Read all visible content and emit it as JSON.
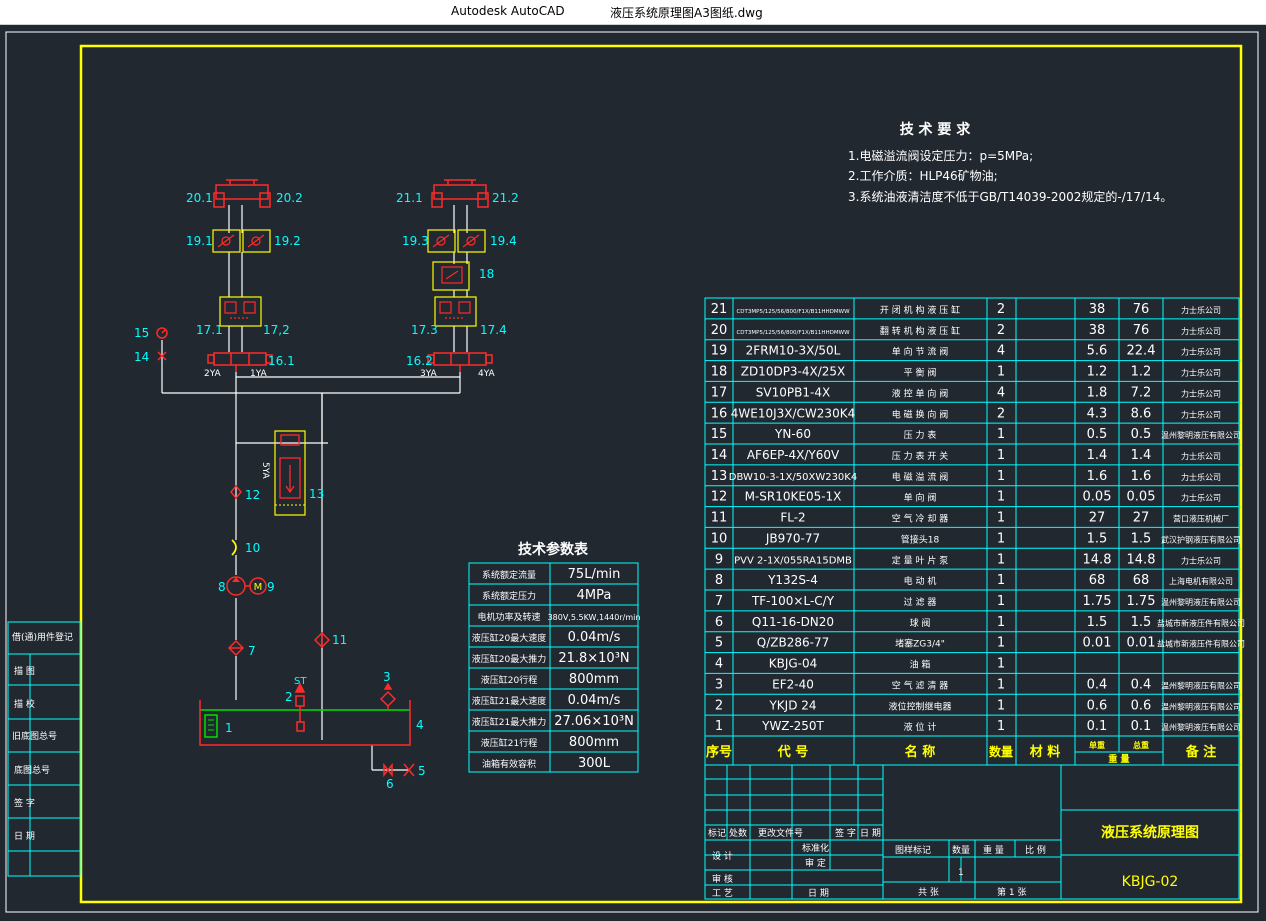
{
  "window": {
    "app_name": "Autodesk AutoCAD",
    "file_name": "液压系统原理图A3图纸.dwg"
  },
  "colors": {
    "background": "#212830",
    "frame": "#ffff00",
    "cyan": "#00ffff",
    "red": "#ff2a2a",
    "white": "#ffffff",
    "green": "#00e000"
  },
  "tech_requirements": {
    "title": "技 术 要 求",
    "lines": [
      "1.电磁溢流阀设定压力：p=5MPa;",
      "2.工作介质：HLP46矿物油;",
      "3.系统油液清洁度不低于GB/T14039-2002规定的-/17/14。"
    ]
  },
  "tech_params": {
    "title": "技术参数表",
    "rows": [
      [
        "系统额定流量",
        "75L/min"
      ],
      [
        "系统额定压力",
        "4MPa"
      ],
      [
        "电机功率及转速",
        "380V,5.5KW,1440r/min"
      ],
      [
        "液压缸20最大速度",
        "0.04m/s"
      ],
      [
        "液压缸20最大推力",
        "21.8×10³N"
      ],
      [
        "液压缸20行程",
        "800mm"
      ],
      [
        "液压缸21最大速度",
        "0.04m/s"
      ],
      [
        "液压缸21最大推力",
        "27.06×10³N"
      ],
      [
        "液压缸21行程",
        "800mm"
      ],
      [
        "油箱有效容积",
        "300L"
      ]
    ]
  },
  "bom": {
    "header": {
      "no": "序号",
      "code": "代    号",
      "name": "名    称",
      "qty": "数量",
      "material": "材  料",
      "unit_weight": "单重",
      "total_weight": "总重",
      "weight": "重  量",
      "remark": "备  注"
    },
    "rows": [
      [
        "21",
        "CDT3MP5/125/56/800/F1X/B11HHDMWW",
        "开 闭 机 构 液 压 缸",
        "2",
        "38",
        "76",
        "力士乐公司"
      ],
      [
        "20",
        "CDT3MP5/125/56/800/F1X/B11HHDMWW",
        "翻 转 机 构 液 压 缸",
        "2",
        "38",
        "76",
        "力士乐公司"
      ],
      [
        "19",
        "2FRM10-3X/50L",
        "单 向 节 流 阀",
        "4",
        "5.6",
        "22.4",
        "力士乐公司"
      ],
      [
        "18",
        "ZD10DP3-4X/25X",
        "平 衡 阀",
        "1",
        "1.2",
        "1.2",
        "力士乐公司"
      ],
      [
        "17",
        "SV10PB1-4X",
        "液 控 单 向 阀",
        "4",
        "1.8",
        "7.2",
        "力士乐公司"
      ],
      [
        "16",
        "4WE10J3X/CW230K4",
        "电 磁 换 向 阀",
        "2",
        "4.3",
        "8.6",
        "力士乐公司"
      ],
      [
        "15",
        "YN-60",
        "压 力 表",
        "1",
        "0.5",
        "0.5",
        "温州黎明液压有限公司"
      ],
      [
        "14",
        "AF6EP-4X/Y60V",
        "压 力 表 开 关",
        "1",
        "1.4",
        "1.4",
        "力士乐公司"
      ],
      [
        "13",
        "DBW10-3-1X/50XW230K4",
        "电 磁 溢 流 阀",
        "1",
        "1.6",
        "1.6",
        "力士乐公司"
      ],
      [
        "12",
        "M-SR10KE05-1X",
        "单 向 阀",
        "1",
        "0.05",
        "0.05",
        "力士乐公司"
      ],
      [
        "11",
        "FL-2",
        "空 气 冷 却 器",
        "1",
        "27",
        "27",
        "营口液压机械厂"
      ],
      [
        "10",
        "JB970-77",
        "管接头18",
        "1",
        "1.5",
        "1.5",
        "武汉护钢液压有限公司"
      ],
      [
        "9",
        "PVV 2-1X/055RA15DMB",
        "定 量 叶 片 泵",
        "1",
        "14.8",
        "14.8",
        "力士乐公司"
      ],
      [
        "8",
        "Y132S-4",
        "电 动 机",
        "1",
        "68",
        "68",
        "上海电机有限公司"
      ],
      [
        "7",
        "TF-100×L-C/Y",
        "过 滤 器",
        "1",
        "1.75",
        "1.75",
        "温州黎明液压有限公司"
      ],
      [
        "6",
        "Q11-16-DN20",
        "球 阀",
        "1",
        "1.5",
        "1.5",
        "盐城市新液压件有限公司"
      ],
      [
        "5",
        "Q/ZB286-77",
        "堵塞ZG3/4\"",
        "1",
        "0.01",
        "0.01",
        "盐城市新液压件有限公司"
      ],
      [
        "4",
        "KBJG-04",
        "油 箱",
        "1",
        "",
        "",
        ""
      ],
      [
        "3",
        "EF2-40",
        "空 气 滤 清 器",
        "1",
        "0.4",
        "0.4",
        "温州黎明液压有限公司"
      ],
      [
        "2",
        "YKJD 24",
        "液位控制继电器",
        "1",
        "0.6",
        "0.6",
        "温州黎明液压有限公司"
      ],
      [
        "1",
        "YWZ-250T",
        "液 位 计",
        "1",
        "0.1",
        "0.1",
        "温州黎明液压有限公司"
      ]
    ]
  },
  "title_block": {
    "drawing_title": "液压系统原理图",
    "drawing_code": "KBJG-02",
    "labels": [
      "标记",
      "处数",
      "更改文件号",
      "签 字",
      "日 期",
      "设 计",
      "标准化",
      "审 定",
      "审 核",
      "工 艺",
      "日 期",
      "图样标记",
      "数量",
      "重 量",
      "比 例",
      "共  张",
      "第 1 张"
    ],
    "quantity": "1"
  },
  "side_stamp": [
    "借(通)用件登记",
    "描   图",
    "描   校",
    "旧底图总号",
    "底图总号",
    "签   字",
    "日   期"
  ],
  "labels": {
    "c20_1": "20.1",
    "c20_2": "20.2",
    "c21_1": "21.1",
    "c21_2": "21.2",
    "v19_1": "19.1",
    "v19_2": "19.2",
    "v19_3": "19.3",
    "v19_4": "19.4",
    "v18": "18",
    "v17_1": "17.1",
    "v17_2": "17,2",
    "v17_3": "17.3",
    "v17_4": "17.4",
    "v16_1": "16.1",
    "v16_2": "16.2",
    "ya1": "1YA",
    "ya2": "2YA",
    "ya3": "3YA",
    "ya4": "4YA",
    "ya5": "5YA",
    "p15": "15",
    "p14": "14",
    "p13": "13",
    "p12": "12",
    "p11": "11",
    "p10": "10",
    "p9": "9",
    "p8": "8",
    "p7": "7",
    "p6": "6",
    "p5": "5",
    "p4": "4",
    "p3": "3",
    "p2": "2",
    "p1": "1",
    "st": "ST",
    "motor": "M"
  }
}
